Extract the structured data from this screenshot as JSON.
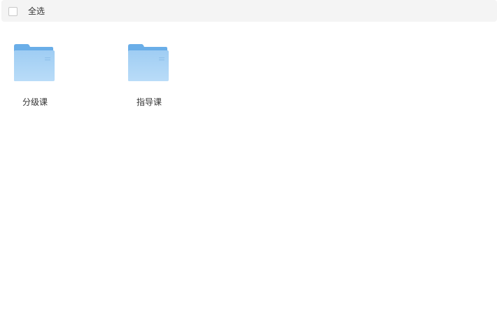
{
  "toolbar": {
    "select_all_label": "全选",
    "select_all_checked": false
  },
  "folders": [
    {
      "name": "分级课",
      "icon": "folder-icon"
    },
    {
      "name": "指导课",
      "icon": "folder-icon"
    }
  ],
  "colors": {
    "toolbar_bg": "#f4f4f4",
    "folder_back": "#6aaee8",
    "folder_front_top": "#9fcdf3",
    "folder_front_bottom": "#b8dbf8"
  }
}
